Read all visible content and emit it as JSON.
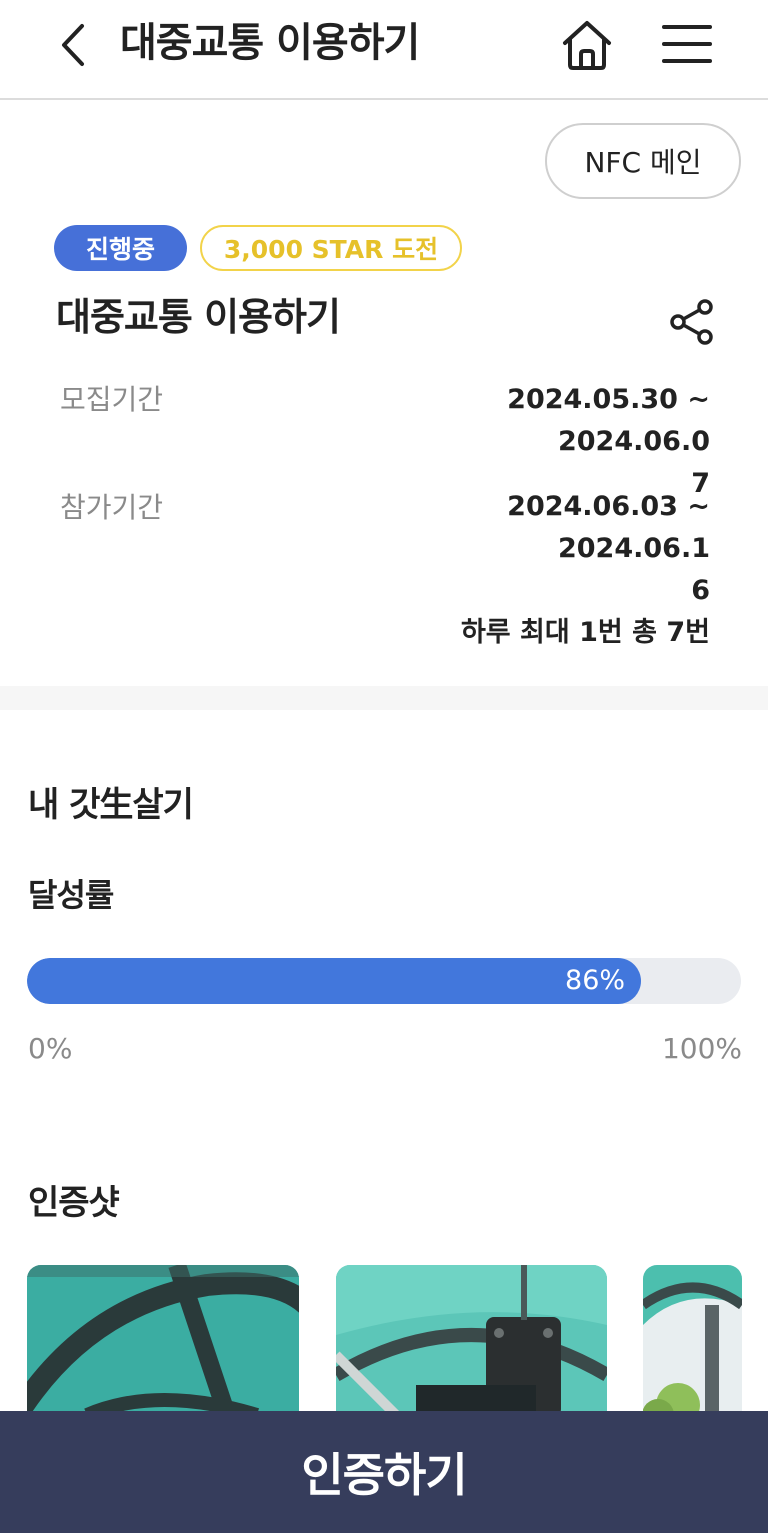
{
  "header": {
    "title": "대중교통 이용하기",
    "back_icon": "chevron-left-icon",
    "home_icon": "home-icon",
    "menu_icon": "hamburger-menu-icon"
  },
  "nfc_button": {
    "label": "NFC 메인"
  },
  "badges": {
    "status": "진행중",
    "reward": "3,000 STAR 도전"
  },
  "challenge": {
    "title": "대중교통 이용하기",
    "share_icon": "share-icon"
  },
  "info": {
    "recruit_label": "모집기간",
    "recruit_value_line1": "2024.05.30 ~ 2024.06.0",
    "recruit_value_line2": "7",
    "participate_label": "참가기간",
    "participate_value_line1": "2024.06.03 ~ 2024.06.1",
    "participate_value_line2": "6",
    "participate_rule": "하루 최대 1번 총 7번"
  },
  "my_life": {
    "title": "내 갓生살기"
  },
  "achievement": {
    "title": "달성률",
    "percent": 86,
    "percent_label": "86%",
    "min_label": "0%",
    "max_label": "100%"
  },
  "proof_shots": {
    "title": "인증샷"
  },
  "cta": {
    "label": "인증하기"
  },
  "colors": {
    "primary_blue": "#4277dc",
    "badge_blue": "#4670d8",
    "star_yellow": "#f2d34a",
    "cta_navy": "#363d5c"
  }
}
